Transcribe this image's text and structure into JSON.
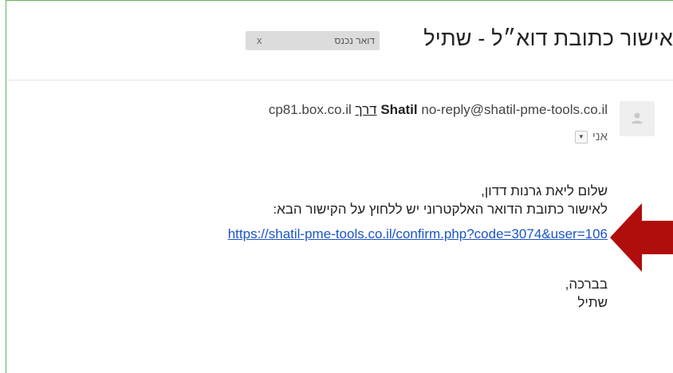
{
  "subject": {
    "title": "אישור כתובת דוא״ל - שתיל",
    "label": "דואר נכנס",
    "label_close": "x"
  },
  "sender": {
    "name": "Shatil",
    "email": "no-reply@shatil-pme-tools.co.il",
    "via_label": "דרך",
    "via_domain": "cp81.box.co.il",
    "to_label": "אני",
    "to_dropdown_icon": "triangle-down"
  },
  "body": {
    "greeting": "שלום ליאת גרנות דדון,",
    "instruction": "לאישור כתובת הדואר האלקטרוני יש ללחוץ על הקישור הבא:",
    "link": "https://shatil-pme-tools.co.il/confirm.php?code=3074&user=106",
    "closing": "בברכה,",
    "signature": "שתיל"
  },
  "colors": {
    "frame_border": "#5fb55c",
    "link": "#1a55c8",
    "arrow": "#b00d0d",
    "label_bg": "#dcdcdc"
  },
  "icons": {
    "avatar": "default-person-icon",
    "arrow": "red-arrow-pointing-left"
  }
}
